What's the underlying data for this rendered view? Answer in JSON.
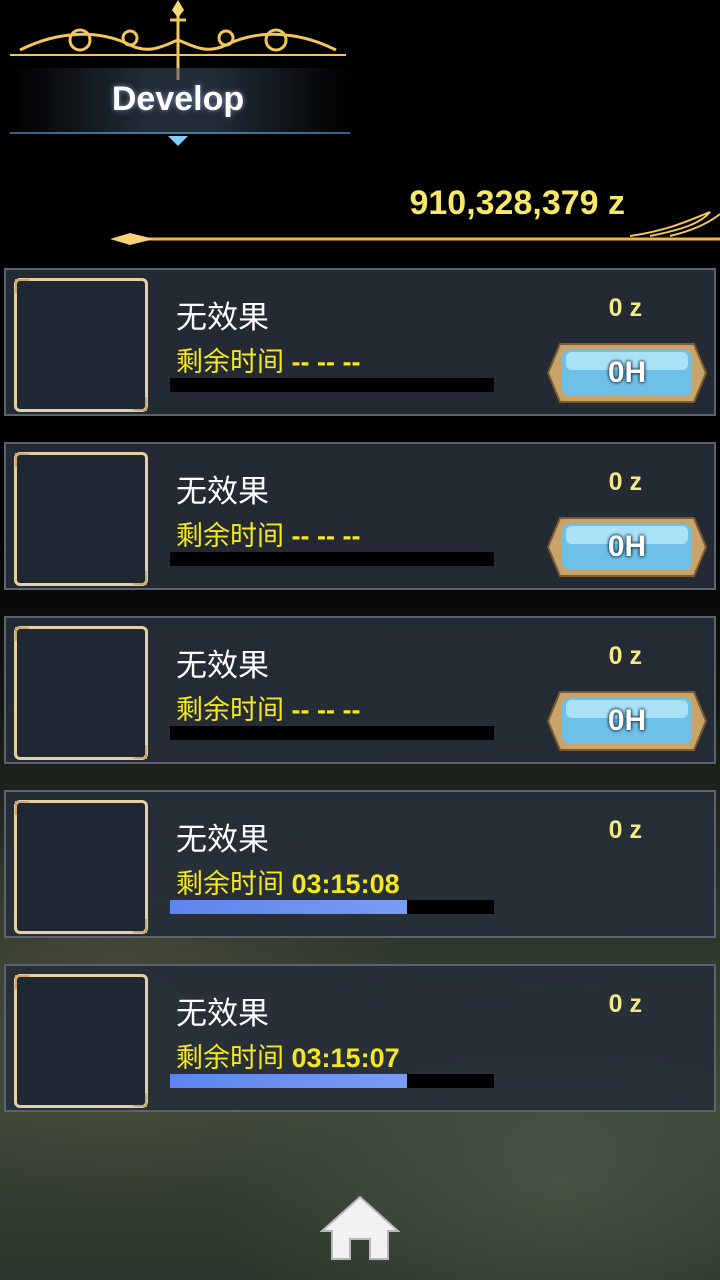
{
  "header": {
    "title": "Develop"
  },
  "wallet": {
    "money": "910,328,379 z"
  },
  "slots": [
    {
      "effect": "无效果",
      "time_label": "剩余时间",
      "time_value": "-- -- --",
      "cost": "0 z",
      "button": "0H",
      "progress": 0
    },
    {
      "effect": "无效果",
      "time_label": "剩余时间",
      "time_value": "-- -- --",
      "cost": "0 z",
      "button": "0H",
      "progress": 0
    },
    {
      "effect": "无效果",
      "time_label": "剩余时间",
      "time_value": "-- -- --",
      "cost": "0 z",
      "button": "0H",
      "progress": 0
    },
    {
      "effect": "无效果",
      "time_label": "剩余时间",
      "time_value": "03:15:08",
      "cost": "0 z",
      "progress": 0.73
    },
    {
      "effect": "无效果",
      "time_label": "剩余时间",
      "time_value": "03:15:07",
      "cost": "0 z",
      "progress": 0.73
    }
  ],
  "nav": {
    "home_icon": "house-icon"
  },
  "colors": {
    "gold": "#f7e76a",
    "time_yellow": "#f5e81e",
    "progress_blue": "#6a8ff0"
  }
}
